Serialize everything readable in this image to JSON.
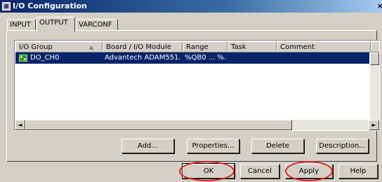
{
  "window": {
    "title": "I/O Configuration",
    "close_glyph": "×"
  },
  "tabs": [
    {
      "label": "INPUT",
      "active": false
    },
    {
      "label": "OUTPUT",
      "active": true
    },
    {
      "label": "VARCONF",
      "active": false
    }
  ],
  "list": {
    "columns": [
      "I/O Group",
      "Board / I/O Module",
      "Range",
      "Task",
      "Comment"
    ],
    "sort_indicator": "▲",
    "rows": [
      {
        "group": "DO_CH0",
        "module": "Advantech ADAM551...",
        "range": "%QB0 ... %...",
        "task": "",
        "comment": "",
        "selected": true
      }
    ]
  },
  "scrollbar": {
    "left_arrow": "◄",
    "right_arrow": "►"
  },
  "panel_buttons": {
    "add": "Add...",
    "properties": "Properties...",
    "delete": "Delete",
    "description": "Description..."
  },
  "dialog_buttons": {
    "ok": "OK",
    "cancel": "Cancel",
    "apply": "Apply",
    "help": "Help"
  },
  "colors": {
    "selection": "#0a246a",
    "face": "#d4d0c8",
    "annotation": "#e02020"
  }
}
